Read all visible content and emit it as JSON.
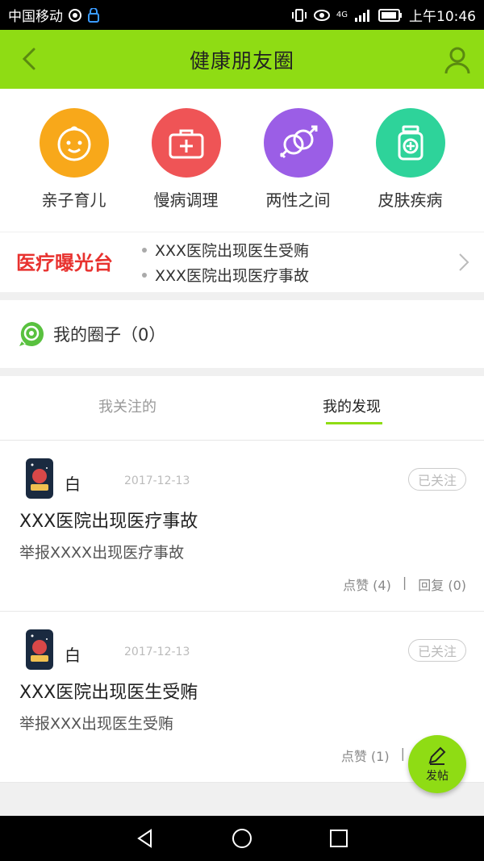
{
  "status_bar": {
    "carrier": "中国移动",
    "network": "4G",
    "time": "上午10:46"
  },
  "nav": {
    "title": "健康朋友圈",
    "back_icon": "chevron-left-icon",
    "user_icon": "user-icon"
  },
  "categories": [
    {
      "label": "亲子育儿",
      "icon": "baby-face-icon",
      "color": "#f8a81a"
    },
    {
      "label": "慢病调理",
      "icon": "medical-kit-icon",
      "color": "#ef5456"
    },
    {
      "label": "两性之间",
      "icon": "gender-icon",
      "color": "#9b5ee6"
    },
    {
      "label": "皮肤疾病",
      "icon": "medicine-bottle-icon",
      "color": "#2ed39a"
    }
  ],
  "banner": {
    "logo_text": "医疗曝光台",
    "news": [
      "XXX医院出现医生受贿",
      "XXX医院出现医疗事故"
    ]
  },
  "my_circle": {
    "label": "我的圈子（0）"
  },
  "tabs": [
    {
      "label": "我关注的",
      "active": false
    },
    {
      "label": "我的发现",
      "active": true
    }
  ],
  "posts": [
    {
      "author": "白",
      "date": "2017-12-13",
      "follow_label": "已关注",
      "title": "XXX医院出现医疗事故",
      "body": "举报XXXX出现医疗事故",
      "likes": "点赞 (4)",
      "separator": "|",
      "replies": "回复 (0)"
    },
    {
      "author": "白",
      "date": "2017-12-13",
      "follow_label": "已关注",
      "title": "XXX医院出现医生受贿",
      "body": "举报XXX出现医生受贿",
      "likes": "点赞 (1)",
      "separator": "|",
      "replies": ""
    }
  ],
  "fab": {
    "label": "发帖",
    "icon": "pencil-icon"
  },
  "colors": {
    "accent": "#8fdc14",
    "brand_red": "#e8322f"
  }
}
